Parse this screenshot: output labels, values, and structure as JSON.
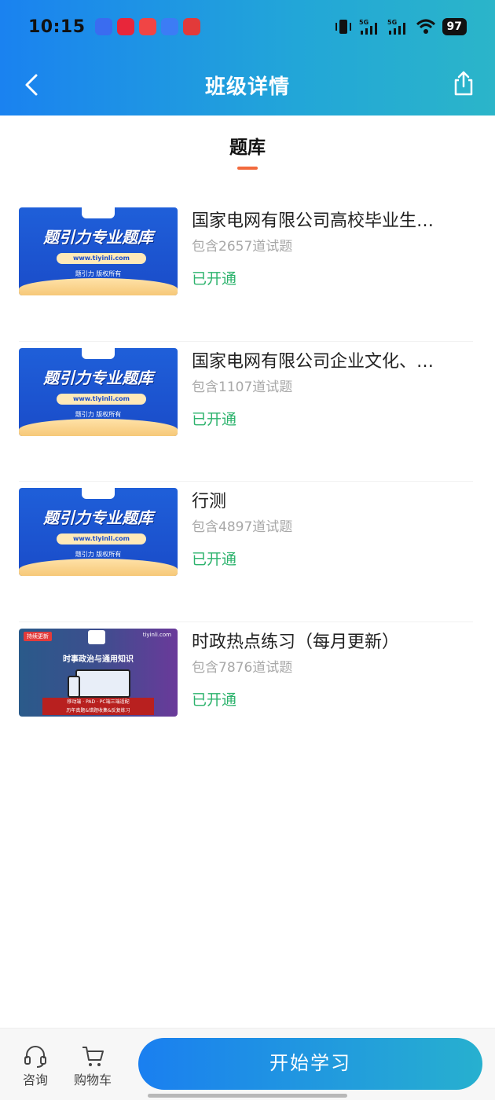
{
  "status_bar": {
    "time": "10:15",
    "battery": "97",
    "signal_1": "5G",
    "signal_2": "5G"
  },
  "nav": {
    "title": "班级详情"
  },
  "tab": {
    "label": "题库"
  },
  "thumb_text": {
    "headline": "题引力专业题库",
    "url": "www.tiyinli.com",
    "copyright": "题引力 版权所有",
    "tag": "持续更新",
    "site": "tiyinli.com",
    "title2": "时事政治与通用知识",
    "red_line1": "移动端 · PAD · PC端三端适配",
    "red_line2": "历年真题&错题收集&反复练习"
  },
  "items": [
    {
      "title": "国家电网有限公司高校毕业生…",
      "count": "包含2657道试题",
      "status": "已开通",
      "thumb": "blue"
    },
    {
      "title": "国家电网有限公司企业文化、…",
      "count": "包含1107道试题",
      "status": "已开通",
      "thumb": "blue"
    },
    {
      "title": "行测",
      "count": "包含4897道试题",
      "status": "已开通",
      "thumb": "blue"
    },
    {
      "title": "时政热点练习（每月更新）",
      "count": "包含7876道试题",
      "status": "已开通",
      "thumb": "purple"
    }
  ],
  "bottom": {
    "consult_label": "咨询",
    "cart_label": "购物车",
    "start_label": "开始学习"
  },
  "colors": {
    "accent_blue": "#1a82f0",
    "status_green": "#2db36d",
    "tab_underline": "#f26a3d"
  }
}
